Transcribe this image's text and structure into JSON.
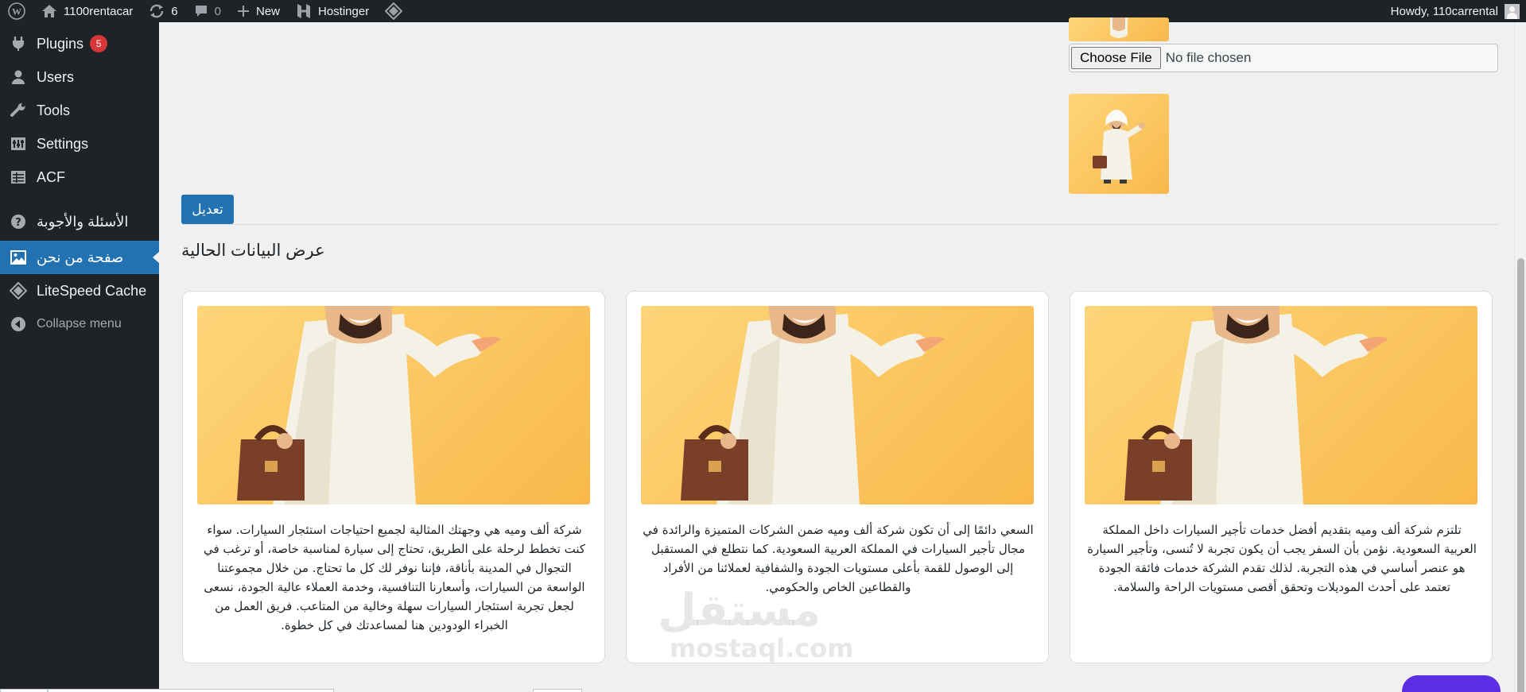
{
  "admin_bar": {
    "site_name": "1100rentacar",
    "updates_count": "6",
    "comments_count": "0",
    "new_label": "New",
    "hostinger_label": "Hostinger",
    "howdy": "Howdy, 110carrental"
  },
  "sidebar": {
    "items": [
      {
        "label": "Plugins",
        "icon": "plugin-icon",
        "badge": "5"
      },
      {
        "label": "Users",
        "icon": "users-icon"
      },
      {
        "label": "Tools",
        "icon": "wrench-icon"
      },
      {
        "label": "Settings",
        "icon": "settings-icon"
      },
      {
        "label": "ACF",
        "icon": "acf-icon"
      },
      {
        "label": "الأسئلة والأجوبة",
        "icon": "question-icon"
      },
      {
        "label": "صفحة من نحن",
        "icon": "image-icon",
        "current": true
      },
      {
        "label": "LiteSpeed Cache",
        "icon": "diamond-icon"
      },
      {
        "label": "Collapse menu",
        "icon": "collapse-icon"
      }
    ]
  },
  "form": {
    "choose_file_label": "Choose File",
    "file_status": "No file chosen",
    "edit_button": "تعديل"
  },
  "section": {
    "title": "عرض البيانات الحالية"
  },
  "cards": [
    {
      "text": "تلتزم شركة ألف وميه بتقديم أفضل خدمات تأجير السيارات داخل المملكة العربية السعودية. نؤمن بأن السفر يجب أن يكون تجربة لا تُنسى، وتأجير السيارة هو عنصر أساسي في هذه التجربة. لذلك تقدم الشركة خدمات فائقة الجودة تعتمد على أحدث الموديلات وتحقق أقصى مستويات الراحة والسلامة."
    },
    {
      "text": "السعي دائمًا إلى أن تكون شركة ألف وميه ضمن الشركات المتميزة والرائدة في مجال تأجير السيارات في المملكة العربية السعودية. كما نتطلع في المستقبل إلى الوصول للقمة بأعلى مستويات الجودة والشفافية لعملائنا من الأفراد والقطاعين الخاص والحكومي."
    },
    {
      "text": "شركة ألف وميه هي وجهتك المثالية لجميع احتياجات استئجار السيارات. سواء كنت تخطط لرحلة على الطريق، تحتاج إلى سيارة لمناسبة خاصة، أو ترغب في التجوال في المدينة بأناقة، فإننا نوفر لك كل ما تحتاج. من خلال مجموعتنا الواسعة من السيارات، وأسعارنا التنافسية، وخدمة العملاء عالية الجودة، نسعى لجعل تجربة استئجار السيارات سهلة وخالية من المتاعب. فريق العمل من الخبراء الودودين هنا لمساعدتك في كل خطوة."
    }
  ],
  "watermark": {
    "arabic": "مستقل",
    "latin": "mostaql.com"
  },
  "colors": {
    "admin_bg": "#1d2327",
    "accent": "#2271b1",
    "badge": "#d63638",
    "image_bg": "#fbc863",
    "chat": "#5b2ee3"
  }
}
